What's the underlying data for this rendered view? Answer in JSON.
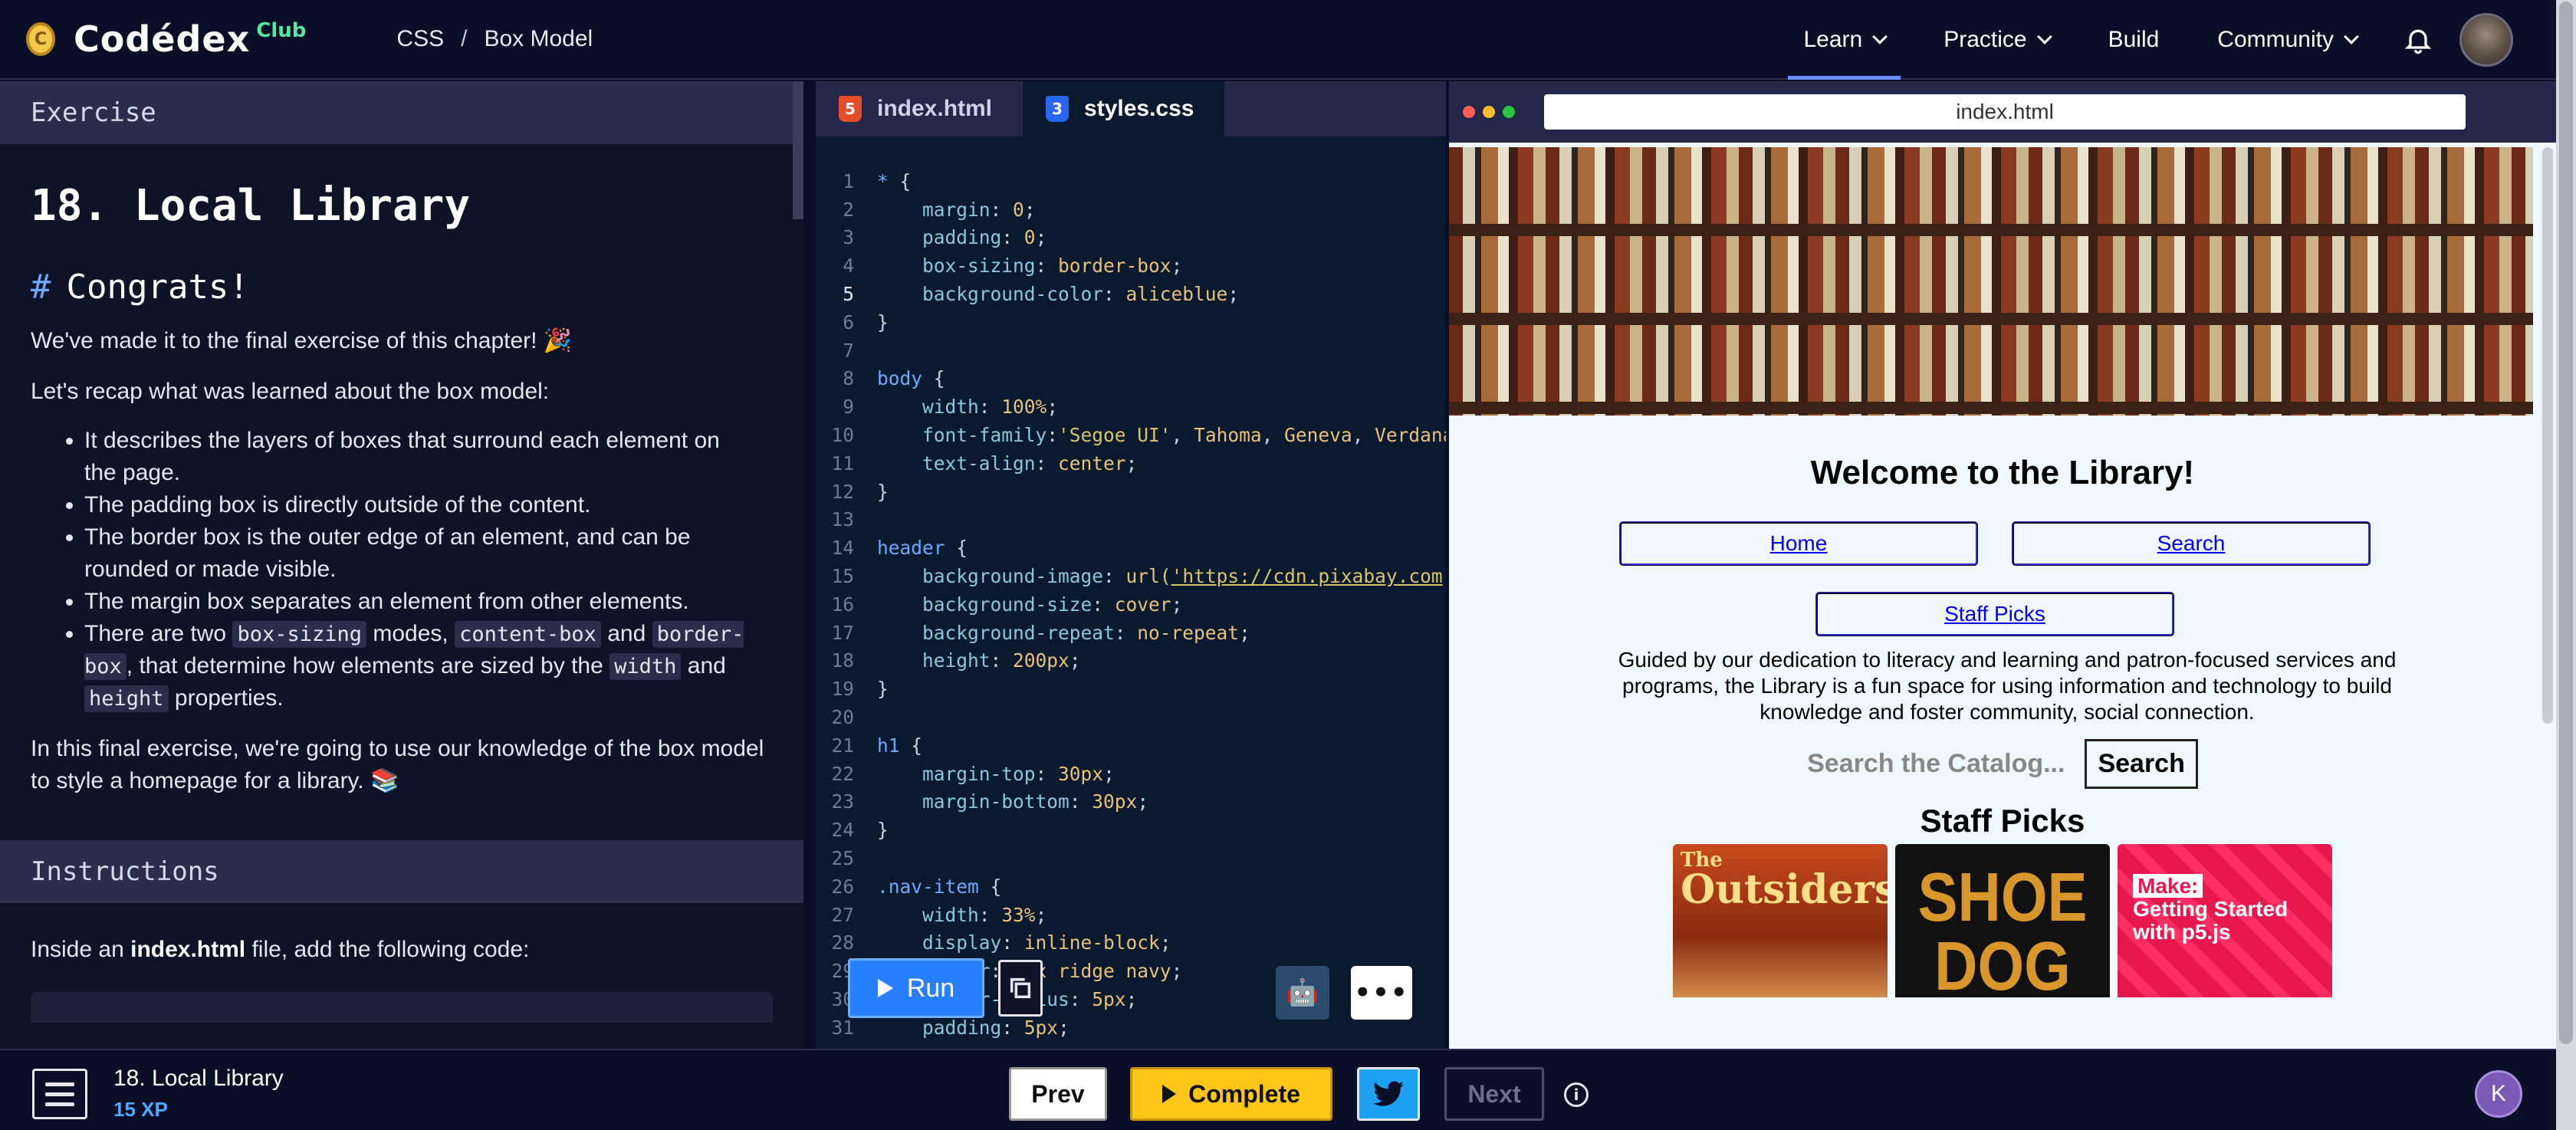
{
  "brand": {
    "coin": "C",
    "name": "Codédex",
    "club": "Club"
  },
  "breadcrumb": [
    "CSS",
    "/",
    "Box Model"
  ],
  "nav": [
    {
      "label": "Learn",
      "dropdown": true,
      "active": true
    },
    {
      "label": "Practice",
      "dropdown": true
    },
    {
      "label": "Build",
      "dropdown": false
    },
    {
      "label": "Community",
      "dropdown": true
    }
  ],
  "exercise": {
    "header": "Exercise",
    "title": "18. Local Library",
    "subheading": "Congrats!",
    "intro": "We've made it to the final exercise of this chapter! 🎉",
    "recap_intro": "Let's recap what was learned about the box model:",
    "bullets": [
      "It describes the layers of boxes that surround each element on the page.",
      "The padding box is directly outside of the content.",
      "The border box is the outer edge of an element, and can be rounded or made visible.",
      "The margin box separates an element from other elements."
    ],
    "bullet5": {
      "a": "There are two",
      "code1": "box-sizing",
      "b": "modes,",
      "code2": "content-box",
      "c": "and",
      "code3": "border-box",
      "d": ", that determine how elements are sized by the",
      "code4": "width",
      "e": "and",
      "code5": "height",
      "f": "properties."
    },
    "closing": "In this final exercise, we're going to use our knowledge of the box model to style a homepage for a library. 📚",
    "instructions_header": "Instructions",
    "instructions_pre": "Inside an",
    "instructions_file": "index.html",
    "instructions_post": "file, add the following code:"
  },
  "editor": {
    "tabs": [
      {
        "label": "index.html",
        "icon": "5",
        "color": "#e44d26",
        "active": false
      },
      {
        "label": "styles.css",
        "icon": "3",
        "color": "#2965f1",
        "active": true
      }
    ],
    "current_line": 5,
    "run_label": "Run",
    "more_label": "•••"
  },
  "preview": {
    "url": "index.html",
    "heading": "Welcome to the Library!",
    "nav_items": [
      "Home",
      "Search",
      "Staff Picks"
    ],
    "about": "Guided by our dedication to literacy and learning and patron-focused services and programs, the Library is a fun space for using information and technology to build knowledge and foster community, social connection.",
    "search_placeholder": "Search the Catalog...",
    "search_button": "Search",
    "staff_heading": "Staff Picks",
    "books": [
      {
        "line1": "The",
        "line2": "Outsiders"
      },
      {
        "line1": "SHOE",
        "line2": "DOG"
      },
      {
        "line1": "Make:",
        "line2": "Getting Started with p5.js"
      }
    ]
  },
  "bottom": {
    "lesson_title": "18. Local Library",
    "xp": "15 XP",
    "prev": "Prev",
    "complete": "Complete",
    "next": "Next",
    "info": "i",
    "user_initial": "K"
  },
  "colors": {
    "accent": "#6c8cff",
    "run": "#2a7fff",
    "complete": "#ffc61a",
    "twitter": "#1da1f2"
  }
}
